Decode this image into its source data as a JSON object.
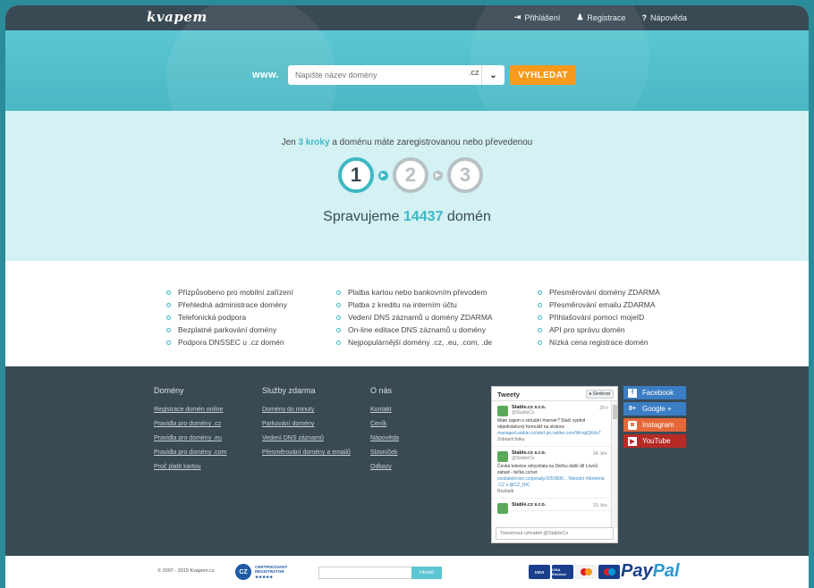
{
  "header": {
    "logo": "kvapem",
    "nav": [
      {
        "icon": "login-icon",
        "glyph": "⇥",
        "label": "Přihlášení"
      },
      {
        "icon": "user-add-icon",
        "glyph": "♟",
        "label": "Registrace"
      },
      {
        "icon": "help-icon",
        "glyph": "?",
        "label": "Nápověda"
      }
    ]
  },
  "search": {
    "prefix": "www.",
    "placeholder": "Napište název domény",
    "tld": ".cz",
    "button": "VYHLEDAT"
  },
  "steps": {
    "title_pre": "Jen ",
    "title_highlight": "3 kroky",
    "title_post": " a doménu máte zaregistrovanou nebo převedenou",
    "items": [
      "1",
      "2",
      "3"
    ],
    "active_step": 1,
    "manage_pre": "Spravujeme ",
    "manage_count": "14437",
    "manage_post": " domén"
  },
  "features": {
    "col1": [
      "Přizpůsobeno pro mobilní zařízení",
      "Přehledná administrace domény",
      "Telefonická podpora",
      "Bezplatné parkování domény",
      "Podpora DNSSEC u .cz domén"
    ],
    "col2": [
      "Platba kartou nebo bankovním převodem",
      "Platba z kreditu na interním účtu",
      "Vedení DNS záznamů u domény ZDARMA",
      "On-line editace DNS záznamů u domény",
      "Nejpopulárnější domény .cz, .eu, .com, .de"
    ],
    "col3": [
      "Přesměrování domény ZDARMA",
      "Přesměrování emailu ZDARMA",
      "Přihlašování pomocí mojeID",
      "API pro správu domén",
      "Nízká cena registrace domén"
    ]
  },
  "footer": {
    "menus": [
      {
        "title": "Domény",
        "links": [
          "Registrace domén online",
          "Pravidla pro domény .cz",
          "Pravidla pro domény .eu",
          "Pravidla pro domény .com",
          "Proč platit kartou"
        ]
      },
      {
        "title": "Služby zdarma",
        "links": [
          "Domény do minuty",
          "Parkování domény",
          "Vedení DNS záznamů",
          "Přesměrování domény a emailů"
        ]
      },
      {
        "title": "O nás",
        "links": [
          "Kontakt",
          "Ceník",
          "Nápověda",
          "Slovníček",
          "Odkazy"
        ]
      }
    ],
    "twitter": {
      "title": "Tweety",
      "follow": "Sledovat",
      "tweets": [
        {
          "name": "Stable.cz s.r.o.",
          "handle": "@StableCz",
          "time": "20 h",
          "text": "Máte zájem o virtuální #server? Stačí vyplnit objednávkový formulář na stránce",
          "link": "managed.stable.cz/start pic.twitter.com/WcrqjQKds7",
          "extra": "Zobrazit fotku"
        },
        {
          "name": "Stable.cz s.r.o.",
          "handle": "@StableCz",
          "time": "24. bře.",
          "text": "Česká televize odvysílala na Déčku další díl Lovců zahad - tečka cz/cet",
          "link": "ceskatelevize.cz/porady/1053606... Národní #doména .CZ s @CZ_NIC",
          "extra": "Rozbalit"
        },
        {
          "name": "Stable.cz s.r.o.",
          "handle": "",
          "time": "23. bře.",
          "text": "",
          "link": "",
          "extra": ""
        }
      ],
      "input_placeholder": "Tweetnout uživateli @StableCz"
    },
    "social": [
      {
        "icon": "facebook-icon",
        "glyph": "f",
        "label": "Facebook",
        "cls": "fb"
      },
      {
        "icon": "google-plus-icon",
        "glyph": "8+",
        "label": "Google +",
        "cls": "gp"
      },
      {
        "icon": "instagram-icon",
        "glyph": "◙",
        "label": "Instagram",
        "cls": "ig"
      },
      {
        "icon": "youtube-icon",
        "glyph": "▶",
        "label": "YouTube",
        "cls": "yt"
      }
    ]
  },
  "bottom": {
    "copyright": "© 2007 - 2015 Kvapem.cz",
    "cz_badge": "CZ",
    "cz_text_1": "CERTIFIKOVANÝ",
    "cz_text_2": "REGISTRÁTOR",
    "cz_stars": "★★★★★",
    "subscribe_button": "Hledat",
    "cards": [
      "VISA",
      "VISA Electron",
      "MasterCard",
      "Maestro"
    ],
    "paypal_a": "Pay",
    "paypal_b": "Pal"
  },
  "colors": {
    "accent": "#3eb8c5",
    "hero": "#5cc6d2",
    "dark": "#3a4a54",
    "orange": "#f79a1c"
  }
}
